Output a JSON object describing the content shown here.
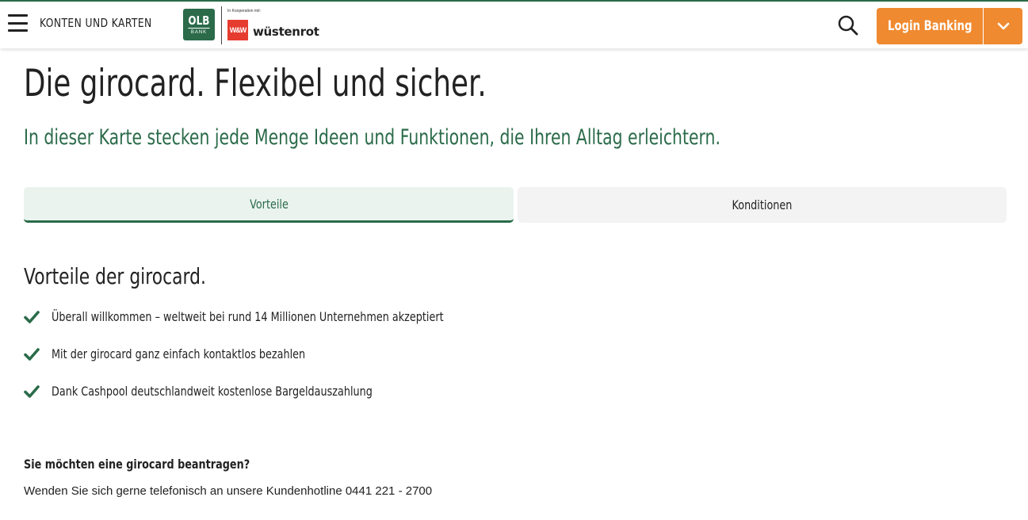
{
  "header": {
    "menu_label": "KONTEN UND KARTEN",
    "brand_logo_text": "OLB",
    "brand_logo_subtext": "BANK",
    "cooperation_label": "In Kooperation mit:",
    "partner_mark": "W&W",
    "partner_name": "wüstenrot",
    "login_label": "Login Banking",
    "accent_color": "#f08a30",
    "brand_color": "#2b6b4a"
  },
  "hero": {
    "title": "Die girocard. Flexibel und sicher.",
    "subtitle": "In dieser Karte stecken jede Menge Ideen und Funktionen, die Ihren Alltag erleichtern."
  },
  "tabs": [
    {
      "label": "Vorteile",
      "active": true
    },
    {
      "label": "Konditionen",
      "active": false
    }
  ],
  "benefits": {
    "heading": "Vorteile der girocard.",
    "items": [
      "Überall willkommen – weltweit bei rund 14 Millionen Unternehmen akzeptiert",
      "Mit der girocard ganz einfach kontaktlos bezahlen",
      "Dank Cashpool deutschlandweit kostenlose Bargeldauszahlung"
    ]
  },
  "apply": {
    "question": "Sie möchten eine girocard beantragen?",
    "answer": "Wenden Sie sich gerne telefonisch an unsere Kundenhotline 0441 221 - 2700"
  }
}
